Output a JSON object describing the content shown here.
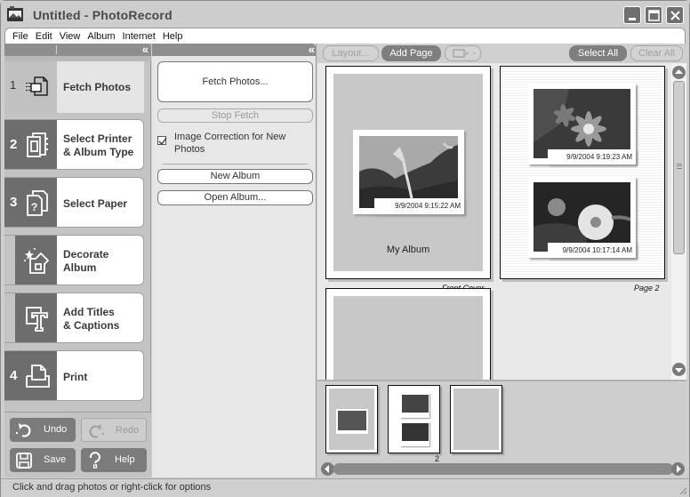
{
  "window": {
    "title": "Untitled - PhotoRecord",
    "controls": [
      "minimize",
      "maximize",
      "close"
    ]
  },
  "menu": [
    "File",
    "Edit",
    "View",
    "Album",
    "Internet",
    "Help"
  ],
  "steps": [
    {
      "num": "1",
      "label_line1": "Fetch Photos",
      "label_line2": "",
      "icon": "fetch-photos-icon",
      "active": true
    },
    {
      "num": "2",
      "label_line1": "Select Printer",
      "label_line2": "& Album Type",
      "icon": "printer-album-icon",
      "active": false
    },
    {
      "num": "3",
      "label_line1": "Select Paper",
      "label_line2": "",
      "icon": "paper-question-icon",
      "active": false
    },
    {
      "num": "",
      "label_line1": "Decorate",
      "label_line2": "Album",
      "icon": "decorate-icon",
      "active": false
    },
    {
      "num": "",
      "label_line1": "Add Titles",
      "label_line2": "& Captions",
      "icon": "titles-icon",
      "active": false
    },
    {
      "num": "4",
      "label_line1": "Print",
      "label_line2": "",
      "icon": "print-icon",
      "active": false
    }
  ],
  "sidebar_buttons": {
    "undo": "Undo",
    "redo": "Redo",
    "save": "Save",
    "help": "Help"
  },
  "center_panel": {
    "fetch_button": "Fetch Photos...",
    "stop_fetch": "Stop Fetch",
    "image_correction_label": "Image Correction for New Photos",
    "image_correction_checked": true,
    "new_album": "New Album",
    "open_album": "Open Album..."
  },
  "toolbar": {
    "layout": "Layout...",
    "add_page": "Add Page",
    "select_all": "Select All",
    "clear_all": "Clear All"
  },
  "pages": [
    {
      "caption": "Front Cover",
      "album_title": "My Album",
      "photos": [
        {
          "timestamp": "9/9/2004 9:15:22 AM"
        }
      ]
    },
    {
      "caption": "Page 2",
      "photos": [
        {
          "timestamp": "9/9/2004 9:19:23 AM"
        },
        {
          "timestamp": "9/9/2004 10:17:14 AM"
        }
      ]
    },
    {
      "caption": "",
      "photos": []
    }
  ],
  "thumbnails": {
    "page_number_label": "2"
  },
  "status": {
    "text": "Click and drag photos or right-click for options"
  }
}
